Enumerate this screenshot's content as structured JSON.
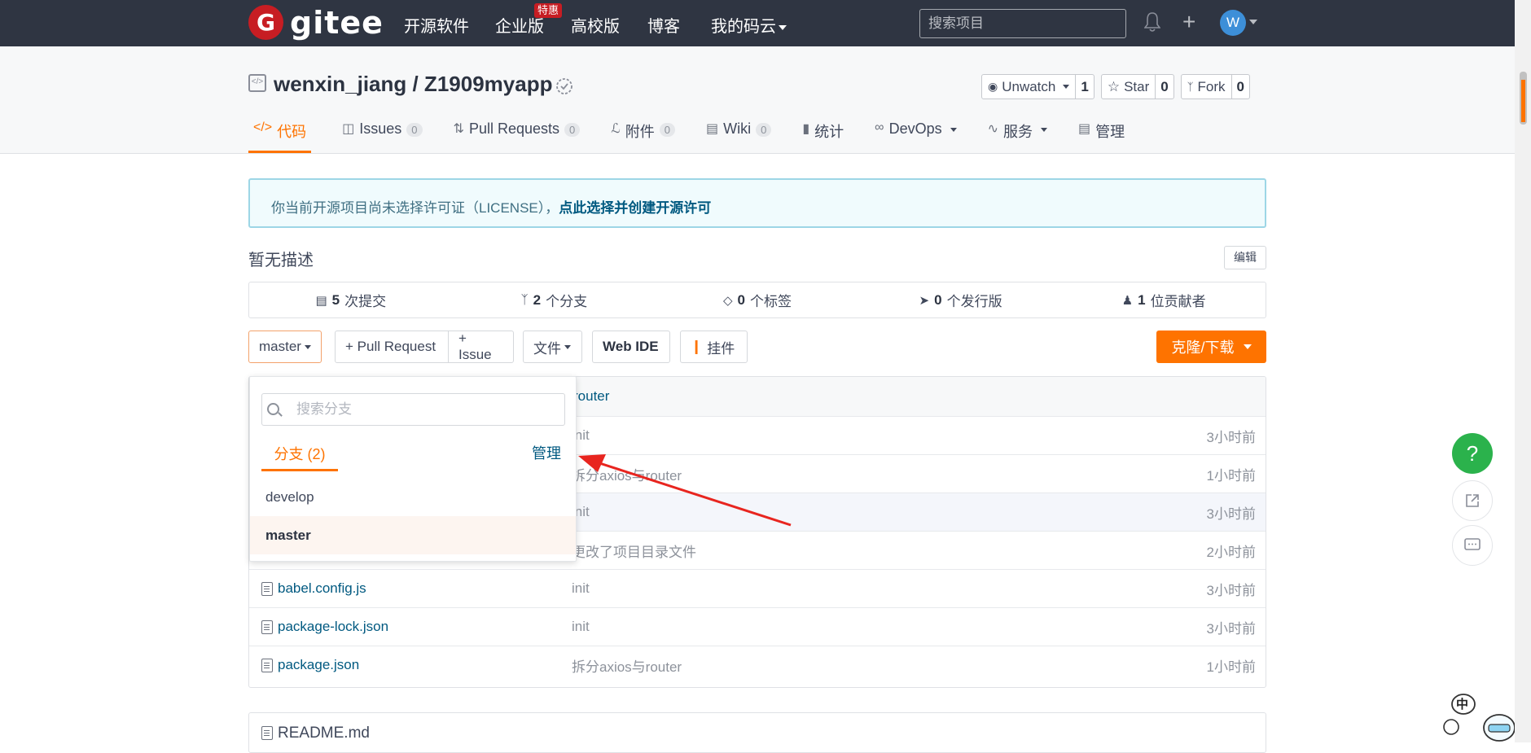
{
  "topnav": {
    "logo_letter": "G",
    "logo_text": "gitee",
    "items": [
      {
        "label": "开源软件"
      },
      {
        "label": "企业版"
      },
      {
        "label": "高校版"
      },
      {
        "label": "博客"
      },
      {
        "label": "我的码云"
      }
    ],
    "hot_badge": "特惠",
    "search_placeholder": "搜索项目",
    "avatar_letter": "W"
  },
  "repo": {
    "title": "wenxin_jiang / Z1909myapp",
    "watch": {
      "label": "Unwatch",
      "count": "1"
    },
    "star": {
      "label": "Star",
      "count": "0"
    },
    "fork": {
      "label": "Fork",
      "count": "0"
    }
  },
  "tabs": [
    {
      "label": "代码",
      "count": ""
    },
    {
      "label": "Issues",
      "count": "0"
    },
    {
      "label": "Pull Requests",
      "count": "0"
    },
    {
      "label": "附件",
      "count": "0"
    },
    {
      "label": "Wiki",
      "count": "0"
    },
    {
      "label": "统计",
      "count": ""
    },
    {
      "label": "DevOps",
      "count": ""
    },
    {
      "label": "服务",
      "count": ""
    },
    {
      "label": "管理",
      "count": ""
    }
  ],
  "license_notice": {
    "text": "你当前开源项目尚未选择许可证（LICENSE），",
    "link": "点此选择并创建开源许可"
  },
  "description": "暂无描述",
  "edit_label": "编辑",
  "stats": [
    {
      "value": "5",
      "label": " 次提交"
    },
    {
      "value": "2",
      "label": " 个分支"
    },
    {
      "value": "0",
      "label": " 个标签"
    },
    {
      "value": "0",
      "label": " 个发行版"
    },
    {
      "value": "1",
      "label": " 位贡献者"
    }
  ],
  "toolbar": {
    "branch": "master",
    "pull_request": "+ Pull Request",
    "issue": "+ Issue",
    "file": "文件",
    "web_ide": "Web IDE",
    "widget": "挂件",
    "clone": "克隆/下载"
  },
  "files": {
    "header_msg": "router",
    "rows": [
      {
        "name": "",
        "msg": "init",
        "time": "3小时前"
      },
      {
        "name": "",
        "msg": "拆分axios与router",
        "time": "1小时前"
      },
      {
        "name": "",
        "msg": "init",
        "time": "3小时前"
      },
      {
        "name": "",
        "msg": "更改了项目目录文件",
        "time": "2小时前"
      },
      {
        "name": "babel.config.js",
        "msg": "init",
        "time": "3小时前"
      },
      {
        "name": "package-lock.json",
        "msg": "init",
        "time": "3小时前"
      },
      {
        "name": "package.json",
        "msg": "拆分axios与router",
        "time": "1小时前"
      }
    ]
  },
  "branch_dropdown": {
    "search_placeholder": "搜索分支",
    "tab_label": "分支 (2)",
    "manage_label": "管理",
    "branches": [
      "develop",
      "master"
    ]
  },
  "readme_label": "README.md",
  "float_help": "?",
  "ime_label": "中",
  "colors": {
    "accent": "#fe7300",
    "nav_bg": "#2f3542",
    "link": "#005980",
    "brand_red": "#c71d23",
    "help_green": "#2bb24c",
    "arrow": "#e8251f"
  }
}
